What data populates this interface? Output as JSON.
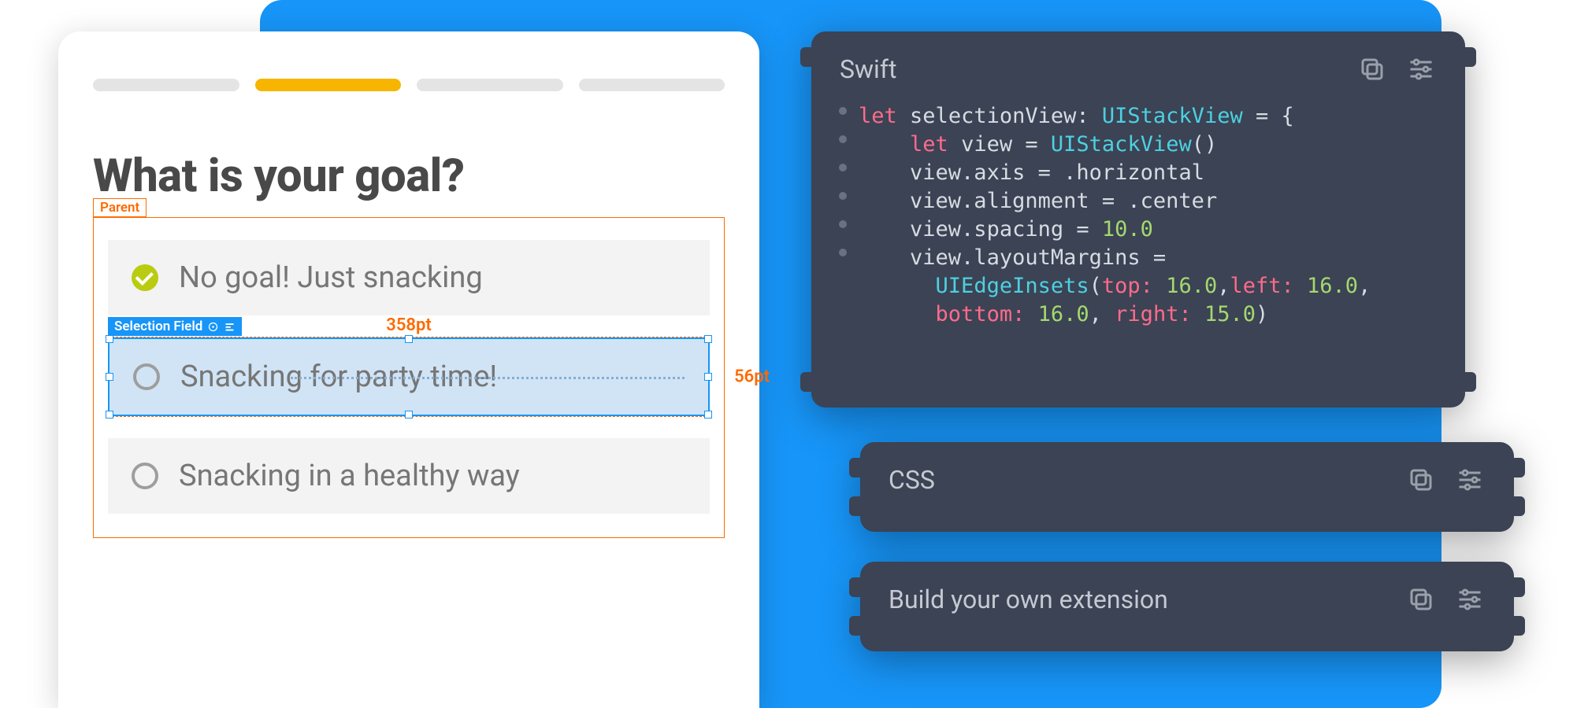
{
  "blue_bg": true,
  "design": {
    "question": "What is your goal?",
    "progress_active_index": 1,
    "parent_label": "Parent",
    "selection_label": "Selection Field",
    "measure_width": "358pt",
    "measure_height": "56pt",
    "options": [
      {
        "text": "No goal! Just snacking",
        "checked": true
      },
      {
        "text": "Snacking for party time!",
        "checked": false,
        "selected": true
      },
      {
        "text": "Snacking in a healthy way",
        "checked": false
      }
    ]
  },
  "panels": {
    "swift": {
      "title": "Swift",
      "code": {
        "l1": {
          "kw": "let",
          "name": "selectionView",
          "type": "UIStackView"
        },
        "l2": {
          "kw": "let",
          "name": "view",
          "type": "UIStackView"
        },
        "l3": {
          "prop": "view.axis",
          "val": ".horizontal"
        },
        "l4": {
          "prop": "view.alignment",
          "val": ".center"
        },
        "l5": {
          "prop": "view.spacing",
          "num": "10.0"
        },
        "l6": {
          "prop": "view.layoutMargins"
        },
        "l7": {
          "type": "UIEdgeInsets",
          "a1": "top:",
          "n1": "16.0",
          "a2": "left:",
          "n2": "16.0"
        },
        "l8": {
          "a3": "bottom:",
          "n3": "16.0",
          "a4": "right:",
          "n4": "15.0"
        }
      }
    },
    "css": {
      "title": "CSS"
    },
    "ext": {
      "title": "Build your own extension"
    }
  }
}
